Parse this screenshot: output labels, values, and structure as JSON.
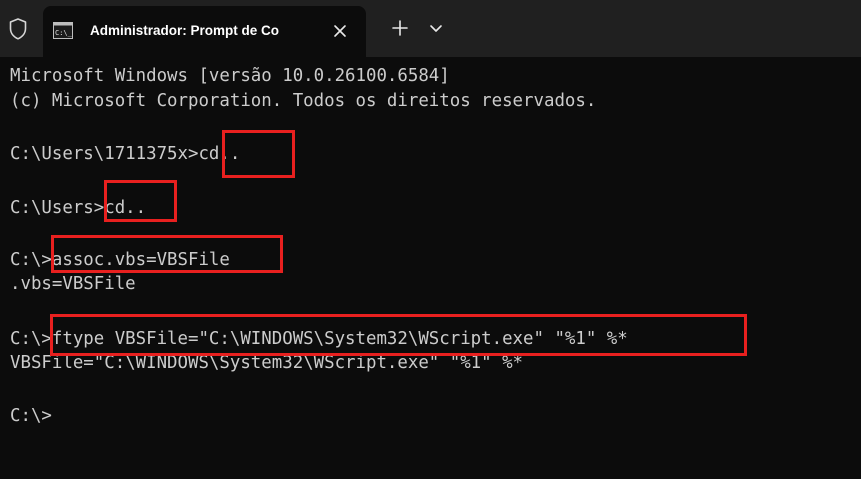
{
  "colors": {
    "tabbar_bg": "#202020",
    "terminal_bg": "#0c0c0c",
    "text": "#cccccc",
    "highlight": "#e8201f"
  },
  "tab": {
    "icon": "cmd-icon",
    "title": "Administrador: Prompt de Co",
    "close_icon": "close-icon"
  },
  "tabbar": {
    "shield_icon": "shield-icon",
    "new_tab_icon": "plus-icon",
    "dropdown_icon": "chevron-down-icon"
  },
  "terminal": {
    "lines": [
      "Microsoft Windows [versão 10.0.26100.6584]",
      "(c) Microsoft Corporation. Todos os direitos reservados.",
      "C:\\Users\\1711375x>cd..",
      "C:\\Users>cd..",
      "C:\\>assoc.vbs=VBSFile",
      ".vbs=VBSFile",
      "C:\\>ftype VBSFile=\"C:\\WINDOWS\\System32\\WScript.exe\" \"%1\" %*",
      "VBSFile=\"C:\\WINDOWS\\System32\\WScript.exe\" \"%1\" %*",
      "C:\\>"
    ]
  }
}
